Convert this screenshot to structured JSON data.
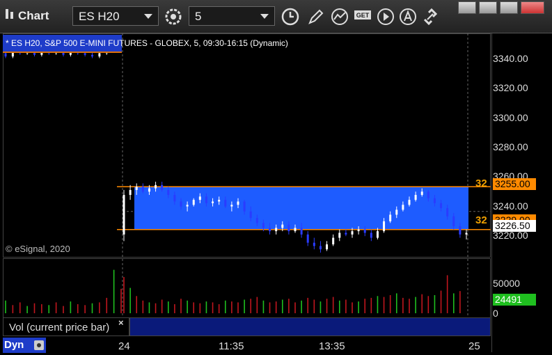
{
  "window": {
    "title": "Chart"
  },
  "toolbar": {
    "symbol": "ES H20",
    "interval": "5",
    "icons": [
      "gear-icon",
      "clock-icon",
      "pencil-icon",
      "study-icon",
      "get-icon",
      "play-icon",
      "alert-icon",
      "link-icon"
    ]
  },
  "chart": {
    "symbol_label": "* ES H20, S&P 500 E-MINI FUTURES - GLOBEX, 5, 09:30-16:15 (Dynamic)",
    "copyright": "© eSignal, 2020",
    "price_labels": [
      "3340.00",
      "3320.00",
      "3300.00",
      "3280.00",
      "3260.00",
      "3240.00",
      "3220.00"
    ],
    "upper_tag": "32",
    "lower_tag": "32",
    "upper_level": "3255.00",
    "lower_level_hidden": "3229.00",
    "last_price": "3226.50",
    "colors": {
      "range_fill": "#1e5cff",
      "level_line": "#ff8a00",
      "up": "#ffffff",
      "down": "#2a3cff"
    }
  },
  "volume": {
    "legend": "Vol (current price bar)",
    "close_glyph": "×",
    "scale_labels": [
      "50000",
      "0"
    ],
    "last_volume": "24491"
  },
  "time_axis": {
    "labels": [
      "24",
      "11:35",
      "13:35",
      "25"
    ],
    "mode_label": "Dyn"
  },
  "chart_data": {
    "type": "candlestick",
    "xlabel": "",
    "ylabel": "",
    "ylim": [
      3212,
      3348
    ],
    "x_ticks": [
      "24",
      "11:35",
      "13:35",
      "25"
    ],
    "bars": [
      [
        3336,
        3337,
        3333,
        3334
      ],
      [
        3334,
        3339,
        3333,
        3338
      ],
      [
        3338,
        3339,
        3335,
        3336
      ],
      [
        3336,
        3338,
        3335,
        3337
      ],
      [
        3337,
        3338,
        3334,
        3335
      ],
      [
        3335,
        3338,
        3334,
        3337
      ],
      [
        3337,
        3338,
        3335,
        3336
      ],
      [
        3336,
        3338,
        3335,
        3337
      ],
      [
        3337,
        3338,
        3334,
        3335
      ],
      [
        3335,
        3338,
        3334,
        3337
      ],
      [
        3337,
        3338,
        3335,
        3336
      ],
      [
        3336,
        3337,
        3334,
        3335
      ],
      [
        3335,
        3337,
        3333,
        3334
      ],
      [
        3334,
        3337,
        3333,
        3336
      ],
      [
        3336,
        3339,
        3335,
        3338
      ],
      [
        3338,
        3341,
        3337,
        3340
      ],
      [
        3340,
        3342,
        3339,
        3341
      ],
      [
        3226,
        3253,
        3222,
        3250
      ],
      [
        3250,
        3256,
        3247,
        3253
      ],
      [
        3253,
        3257,
        3250,
        3255
      ],
      [
        3255,
        3257,
        3251,
        3252
      ],
      [
        3252,
        3256,
        3250,
        3254
      ],
      [
        3254,
        3258,
        3252,
        3256
      ],
      [
        3256,
        3258,
        3252,
        3253
      ],
      [
        3253,
        3255,
        3248,
        3250
      ],
      [
        3250,
        3252,
        3244,
        3246
      ],
      [
        3246,
        3248,
        3241,
        3243
      ],
      [
        3243,
        3246,
        3240,
        3244
      ],
      [
        3244,
        3248,
        3243,
        3247
      ],
      [
        3247,
        3251,
        3245,
        3249
      ],
      [
        3249,
        3251,
        3243,
        3245
      ],
      [
        3245,
        3248,
        3243,
        3246
      ],
      [
        3246,
        3249,
        3244,
        3247
      ],
      [
        3247,
        3249,
        3242,
        3243
      ],
      [
        3243,
        3246,
        3240,
        3244
      ],
      [
        3244,
        3248,
        3242,
        3246
      ],
      [
        3246,
        3247,
        3238,
        3240
      ],
      [
        3240,
        3243,
        3234,
        3236
      ],
      [
        3236,
        3238,
        3231,
        3233
      ],
      [
        3233,
        3235,
        3228,
        3230
      ],
      [
        3230,
        3233,
        3226,
        3228
      ],
      [
        3228,
        3232,
        3226,
        3230
      ],
      [
        3230,
        3234,
        3228,
        3232
      ],
      [
        3232,
        3234,
        3226,
        3228
      ],
      [
        3228,
        3232,
        3227,
        3230
      ],
      [
        3230,
        3233,
        3224,
        3226
      ],
      [
        3226,
        3228,
        3219,
        3221
      ],
      [
        3221,
        3224,
        3217,
        3219
      ],
      [
        3219,
        3222,
        3215,
        3217
      ],
      [
        3217,
        3222,
        3216,
        3220
      ],
      [
        3220,
        3226,
        3219,
        3224
      ],
      [
        3224,
        3229,
        3222,
        3227
      ],
      [
        3227,
        3229,
        3225,
        3226
      ],
      [
        3226,
        3230,
        3224,
        3228
      ],
      [
        3228,
        3231,
        3226,
        3229
      ],
      [
        3229,
        3231,
        3225,
        3227
      ],
      [
        3227,
        3229,
        3222,
        3224
      ],
      [
        3224,
        3230,
        3223,
        3228
      ],
      [
        3228,
        3236,
        3227,
        3234
      ],
      [
        3234,
        3240,
        3233,
        3238
      ],
      [
        3238,
        3243,
        3236,
        3241
      ],
      [
        3241,
        3246,
        3240,
        3244
      ],
      [
        3244,
        3249,
        3243,
        3247
      ],
      [
        3247,
        3252,
        3246,
        3250
      ],
      [
        3250,
        3254,
        3249,
        3252
      ],
      [
        3252,
        3253,
        3246,
        3248
      ],
      [
        3248,
        3250,
        3243,
        3245
      ],
      [
        3245,
        3247,
        3240,
        3242
      ],
      [
        3242,
        3244,
        3235,
        3237
      ],
      [
        3237,
        3239,
        3229,
        3231
      ],
      [
        3231,
        3233,
        3224,
        3226
      ],
      [
        3226,
        3229,
        3223,
        3227
      ]
    ],
    "volume": [
      14000,
      9000,
      12000,
      8000,
      11000,
      10000,
      9000,
      12000,
      8000,
      13000,
      10000,
      9000,
      11000,
      12000,
      17000,
      48000,
      27000,
      40000,
      28000,
      19000,
      14000,
      12000,
      11000,
      15000,
      13000,
      10000,
      16000,
      14000,
      12000,
      11000,
      13000,
      12000,
      10000,
      14000,
      13000,
      12000,
      15000,
      16000,
      18000,
      14000,
      12000,
      13000,
      15000,
      16000,
      12000,
      14000,
      17000,
      15000,
      13000,
      16000,
      18000,
      14000,
      15000,
      12000,
      13000,
      16000,
      17000,
      19000,
      18000,
      20000,
      22000,
      17000,
      16000,
      18000,
      21000,
      19000,
      20000,
      25000,
      42000,
      22000,
      24491
    ]
  }
}
